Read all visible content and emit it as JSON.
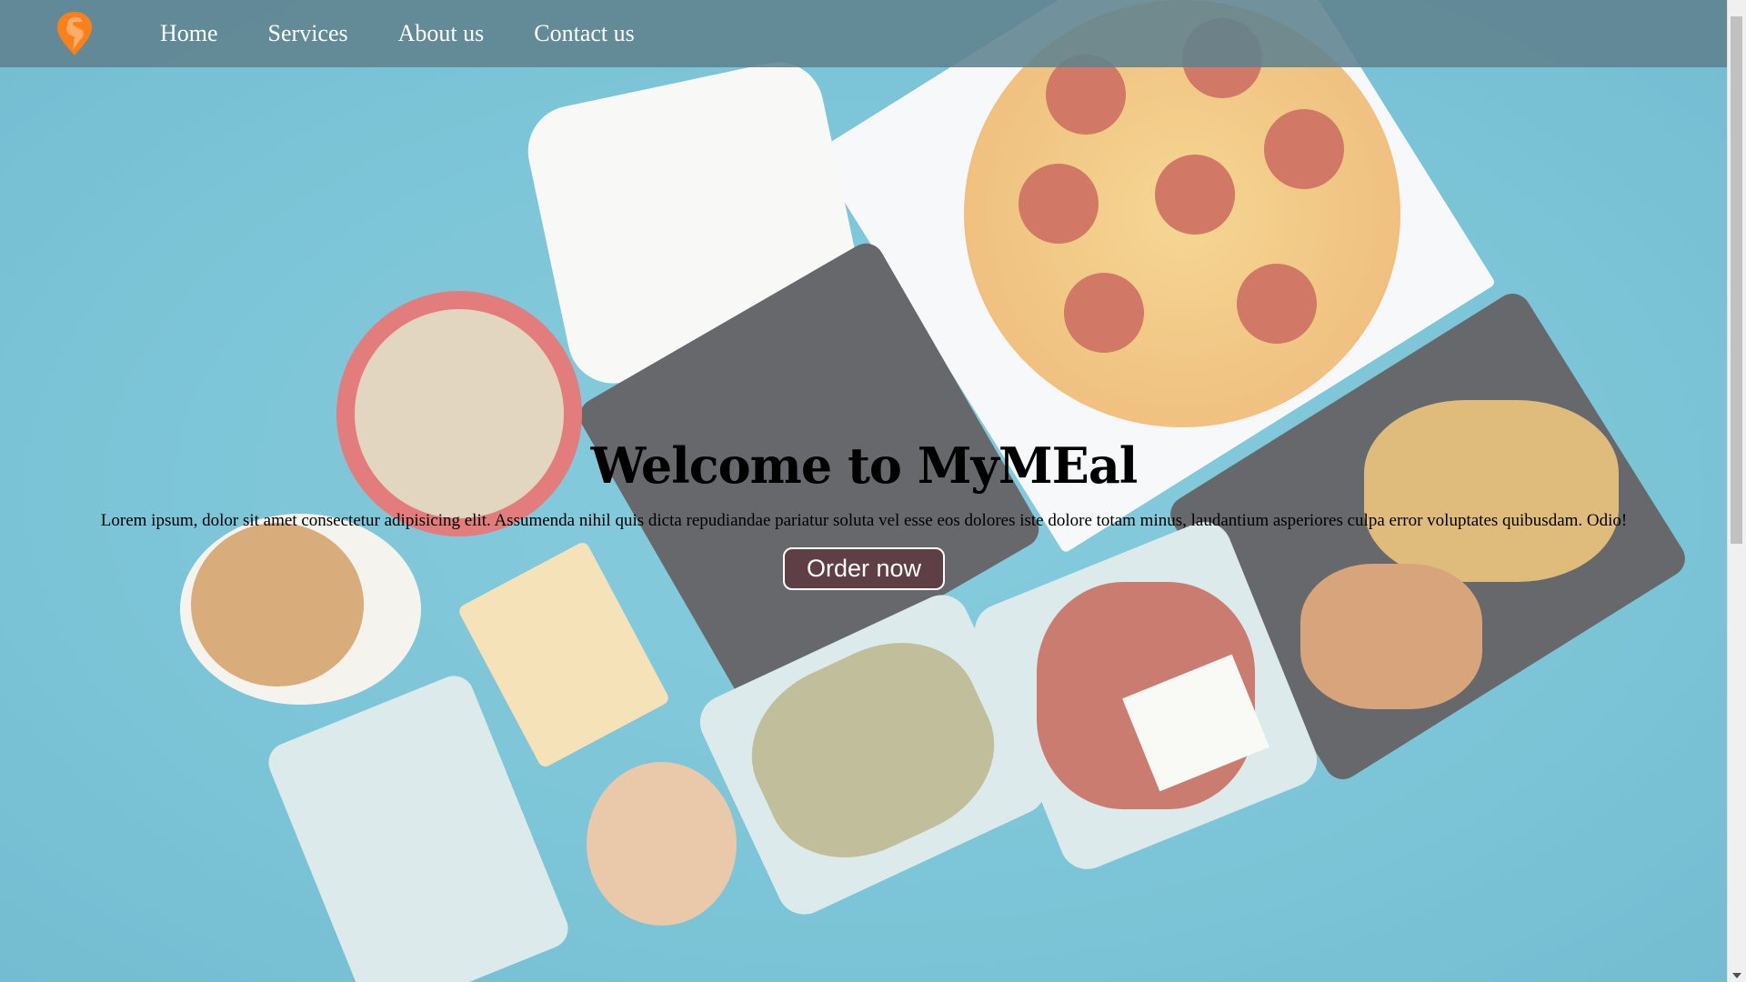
{
  "brand": {
    "logo_icon": "swiggy-logo-icon",
    "color": "#fc8019"
  },
  "nav": {
    "items": [
      {
        "label": "Home"
      },
      {
        "label": "Services"
      },
      {
        "label": "About us"
      },
      {
        "label": "Contact us"
      }
    ]
  },
  "hero": {
    "title": "Welcome to MyMEal",
    "text": "Lorem ipsum, dolor sit amet consectetur adipisicing elit. Assumenda nihil quis dicta repudiandae pariatur soluta vel esse eos dolores iste dolore totam minus, laudantium asperiores culpa error voluptates quibusdam. Odio!",
    "button_label": "Order now"
  }
}
